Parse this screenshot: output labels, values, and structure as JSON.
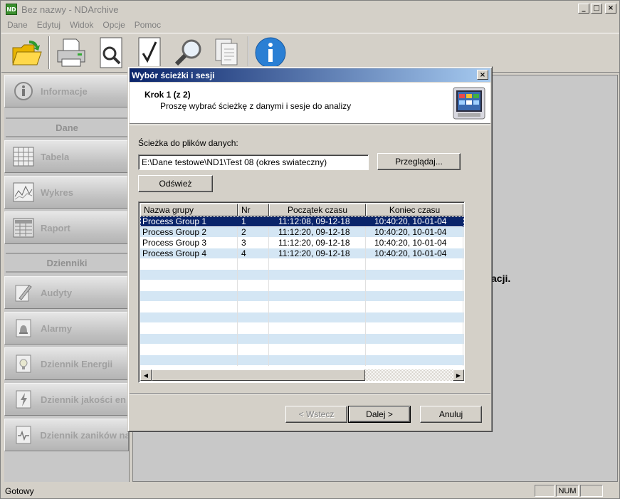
{
  "app": {
    "title": "Bez nazwy - NDArchive",
    "icon_text": "ND",
    "window_buttons": [
      "_",
      "□",
      "×"
    ]
  },
  "menu": [
    "Dane",
    "Edytuj",
    "Widok",
    "Opcje",
    "Pomoc"
  ],
  "toolbar": {
    "buttons": [
      "open-folder-icon",
      "print-icon",
      "print-preview-icon",
      "check-icon",
      "search-icon",
      "copy-icon",
      "info-icon"
    ]
  },
  "sidebar": {
    "items": [
      {
        "label": "Informacje",
        "icon": "info-icon"
      },
      {
        "section": "Dane"
      },
      {
        "label": "Tabela",
        "icon": "table-icon"
      },
      {
        "label": "Wykres",
        "icon": "chart-icon"
      },
      {
        "label": "Raport",
        "icon": "report-icon"
      },
      {
        "section": "Dzienniki"
      },
      {
        "label": "Audyty",
        "icon": "pen-icon"
      },
      {
        "label": "Alarmy",
        "icon": "bell-icon"
      },
      {
        "label": "Dziennik Energii",
        "icon": "bulb-icon"
      },
      {
        "label": "Dziennik jakości en",
        "icon": "lightning-icon"
      },
      {
        "label": "Dziennik zaników na",
        "icon": "wave-icon"
      }
    ]
  },
  "content": {
    "partial_text": "acji."
  },
  "status": {
    "text": "Gotowy",
    "num": "NUM"
  },
  "dialog": {
    "title": "Wybór ścieżki i sesji",
    "step_title": "Krok 1 (z 2)",
    "step_desc": "Proszę wybrać ścieżkę z danymi i sesje do analizy",
    "path_label": "Ścieżka do plików danych:",
    "path_value": "E:\\Dane testowe\\ND1\\Test 08 (okres swiateczny)",
    "browse_label": "Przeglądaj...",
    "refresh_label": "Odśwież",
    "columns": [
      "Nazwa grupy",
      "Nr",
      "Początek czasu",
      "Koniec czasu"
    ],
    "rows": [
      {
        "name": "Process Group 1",
        "nr": "1",
        "start": "11:12:08, 09-12-18",
        "end": "10:40:20, 10-01-04",
        "selected": true
      },
      {
        "name": "Process Group 2",
        "nr": "2",
        "start": "11:12:20, 09-12-18",
        "end": "10:40:20, 10-01-04",
        "selected": false
      },
      {
        "name": "Process Group 3",
        "nr": "3",
        "start": "11:12:20, 09-12-18",
        "end": "10:40:20, 10-01-04",
        "selected": false
      },
      {
        "name": "Process Group 4",
        "nr": "4",
        "start": "11:12:20, 09-12-18",
        "end": "10:40:20, 10-01-04",
        "selected": false
      }
    ],
    "back_label": "< Wstecz",
    "next_label": "Dalej >",
    "cancel_label": "Anuluj"
  }
}
